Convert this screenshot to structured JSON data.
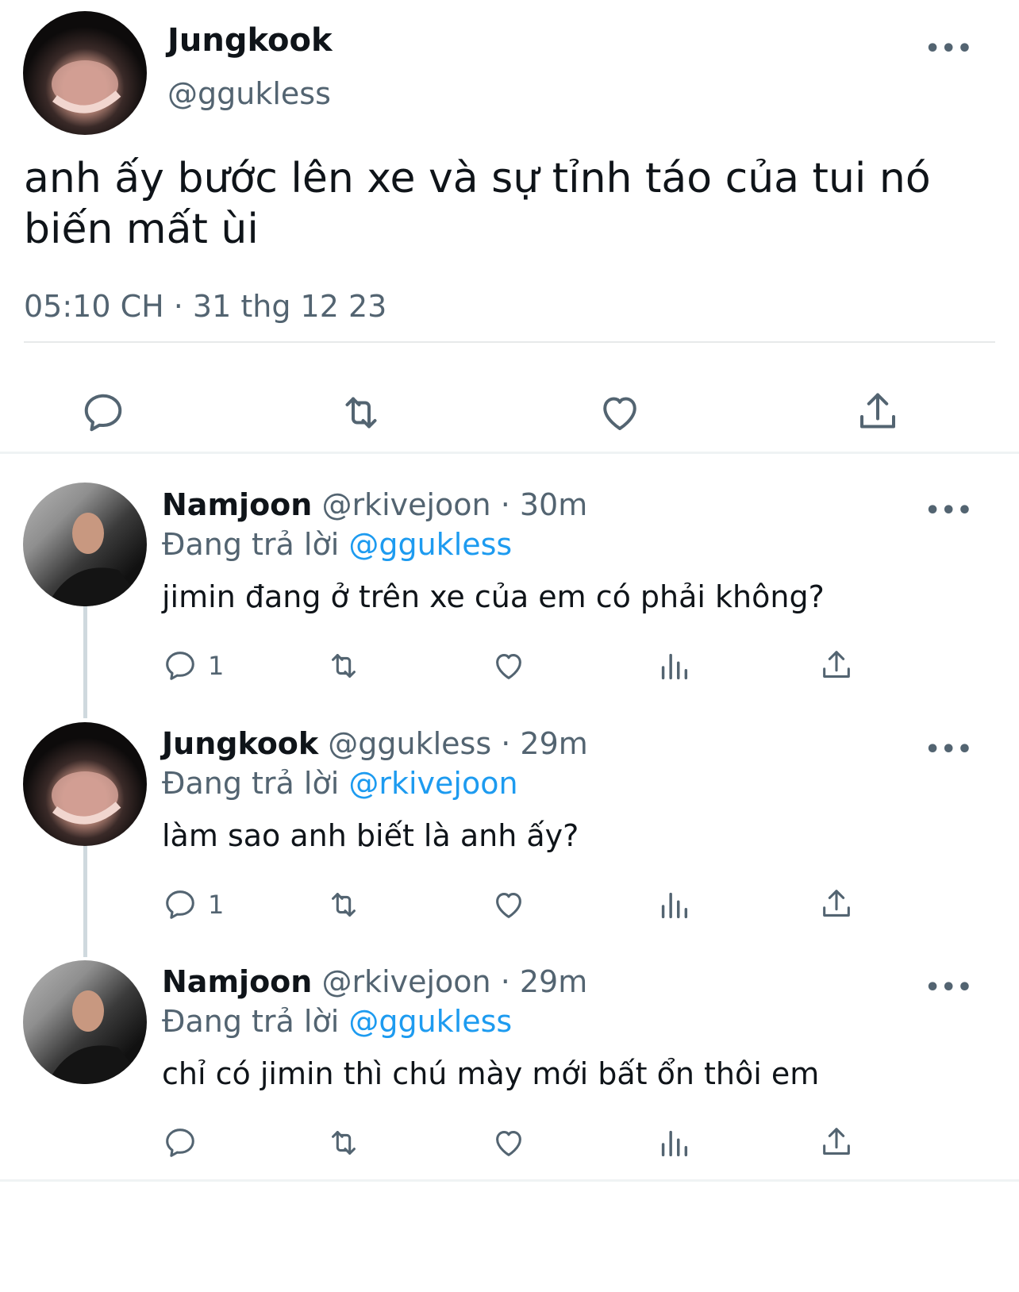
{
  "main_tweet": {
    "name": "Jungkook",
    "handle": "@ggukless",
    "text": "anh ấy bước lên xe và sự tỉnh táo của tui nó biến mất ùi",
    "timestamp": "05:10 CH · 31 thg 12 23",
    "more_label": "•••"
  },
  "replies": [
    {
      "name": "Namjoon",
      "handle": "@rkivejoon",
      "time": " · 30m",
      "replying_prefix": "Đang trả lời ",
      "replying_to": "@ggukless",
      "text": "jimin đang ở trên xe của em có phải không?",
      "reply_count": "1",
      "more_label": "•••"
    },
    {
      "name": "Jungkook",
      "handle": "@ggukless",
      "time": " · 29m",
      "replying_prefix": "Đang trả lời ",
      "replying_to": "@rkivejoon",
      "text": "làm sao anh biết là anh ấy?",
      "reply_count": "1",
      "more_label": "•••"
    },
    {
      "name": "Namjoon",
      "handle": "@rkivejoon",
      "time": " · 29m",
      "replying_prefix": "Đang trả lời ",
      "replying_to": "@ggukless",
      "text": "chỉ có jimin thì chú mày mới bất ổn thôi em",
      "reply_count": "",
      "more_label": "•••"
    }
  ],
  "icons": {
    "reply": "reply-bubble-icon",
    "retweet": "retweet-icon",
    "like": "heart-icon",
    "views": "views-bar-icon",
    "share": "share-upload-icon",
    "more": "more-dots-icon"
  },
  "colors": {
    "text": "#0f1419",
    "secondary": "#536471",
    "mention": "#1d9bf0",
    "divider": "#e7e9ea",
    "thread_line": "#cfd9de"
  }
}
